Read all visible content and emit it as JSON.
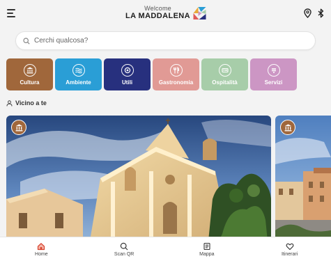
{
  "header": {
    "welcome": "Welcome",
    "title": "LA MADDALENA"
  },
  "search": {
    "placeholder": "Cerchi qualcosa?"
  },
  "categories": [
    {
      "label": "Cultura",
      "color": "#a0673b",
      "icon": "museum-icon"
    },
    {
      "label": "Ambiente",
      "color": "#2a9ed6",
      "icon": "waves-icon"
    },
    {
      "label": "Utili",
      "color": "#27307e",
      "icon": "info-icon"
    },
    {
      "label": "Gastronomia",
      "color": "#e19a95",
      "icon": "cutlery-icon"
    },
    {
      "label": "Ospitalità",
      "color": "#a7cda9",
      "icon": "bed-icon"
    },
    {
      "label": "Servizi",
      "color": "#cc96c4",
      "icon": "services-icon"
    }
  ],
  "nearby": {
    "title": "Vicino a te"
  },
  "cards": [
    {
      "category": "Cultura",
      "badge_color": "#a0673b"
    },
    {
      "category": "Cultura",
      "badge_color": "#a0673b"
    }
  ],
  "bottom_nav": [
    {
      "label": "Home",
      "icon": "home-icon",
      "active": true,
      "color": "#d8432e"
    },
    {
      "label": "Scan QR",
      "icon": "search-icon",
      "active": false
    },
    {
      "label": "Mappa",
      "icon": "map-icon",
      "active": false
    },
    {
      "label": "Itinerari",
      "icon": "heart-icon",
      "active": false
    }
  ]
}
